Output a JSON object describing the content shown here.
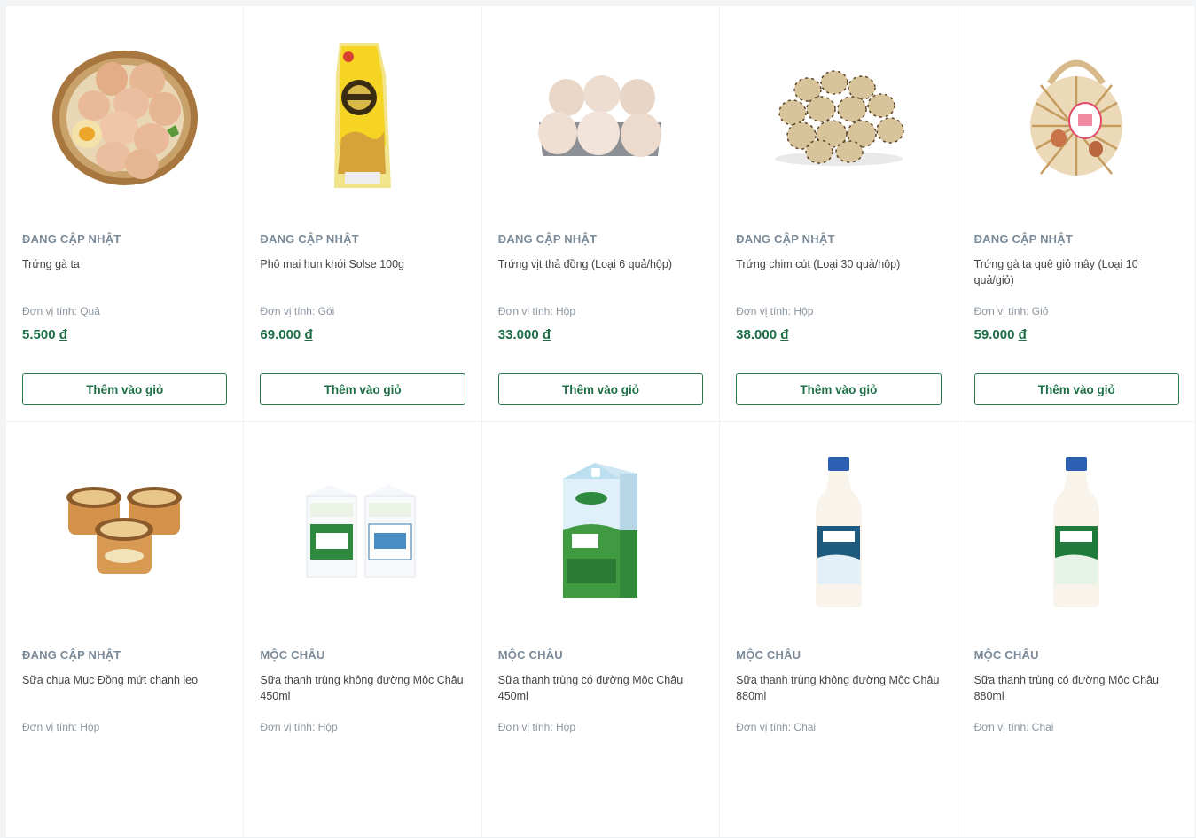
{
  "products": [
    {
      "brand": "ĐANG CẬP NHẬT",
      "name": "Trứng gà ta",
      "unit": "Đơn vị tính: Quả",
      "price": "5.500",
      "currency": "đ",
      "button": "Thêm vào giỏ",
      "image": "egg-basket"
    },
    {
      "brand": "ĐANG CẬP NHẬT",
      "name": "Phô mai hun khói Solse 100g",
      "unit": "Đơn vị tính: Gói",
      "price": "69.000",
      "currency": "đ",
      "button": "Thêm vào giỏ",
      "image": "cheese-pack"
    },
    {
      "brand": "ĐANG CẬP NHẬT",
      "name": "Trứng vịt thả đồng (Loại 6 quả/hộp)",
      "unit": "Đơn vị tính: Hộp",
      "price": "33.000",
      "currency": "đ",
      "button": "Thêm vào giỏ",
      "image": "duck-eggs-tray"
    },
    {
      "brand": "ĐANG CẬP NHẬT",
      "name": "Trứng chim cút (Loại 30 quả/hộp)",
      "unit": "Đơn vị tính: Hộp",
      "price": "38.000",
      "currency": "đ",
      "button": "Thêm vào giỏ",
      "image": "quail-eggs"
    },
    {
      "brand": "ĐANG CẬP NHẬT",
      "name": "Trứng gà ta quê giỏ mây (Loại 10 quả/giỏ)",
      "unit": "Đơn vị tính: Giỏ",
      "price": "59.000",
      "currency": "đ",
      "button": "Thêm vào giỏ",
      "image": "rattan-basket"
    },
    {
      "brand": "ĐANG CẬP NHẬT",
      "name": "Sữa chua Mục Đồng mứt chanh leo",
      "unit": "Đơn vị tính: Hộp",
      "image": "yogurt-cups"
    },
    {
      "brand": "MỘC CHÂU",
      "name": "Sữa thanh trùng không đường Mộc Châu 450ml",
      "unit": "Đơn vị tính: Hộp",
      "image": "milk-cartons-small"
    },
    {
      "brand": "MỘC CHÂU",
      "name": "Sữa thanh trùng có đường Mộc Châu 450ml",
      "unit": "Đơn vị tính: Hộp",
      "image": "milk-carton"
    },
    {
      "brand": "MỘC CHÂU",
      "name": "Sữa thanh trùng không đường Mộc Châu 880ml",
      "unit": "Đơn vị tính: Chai",
      "image": "milk-bottle-blue"
    },
    {
      "brand": "MỘC CHÂU",
      "name": "Sữa thanh trùng có đường Mộc Châu 880ml",
      "unit": "Đơn vị tính: Chai",
      "image": "milk-bottle-green"
    }
  ],
  "colors": {
    "accent": "#1e6d46",
    "brand_text": "#7b8a99",
    "border": "#2b7a4f"
  }
}
